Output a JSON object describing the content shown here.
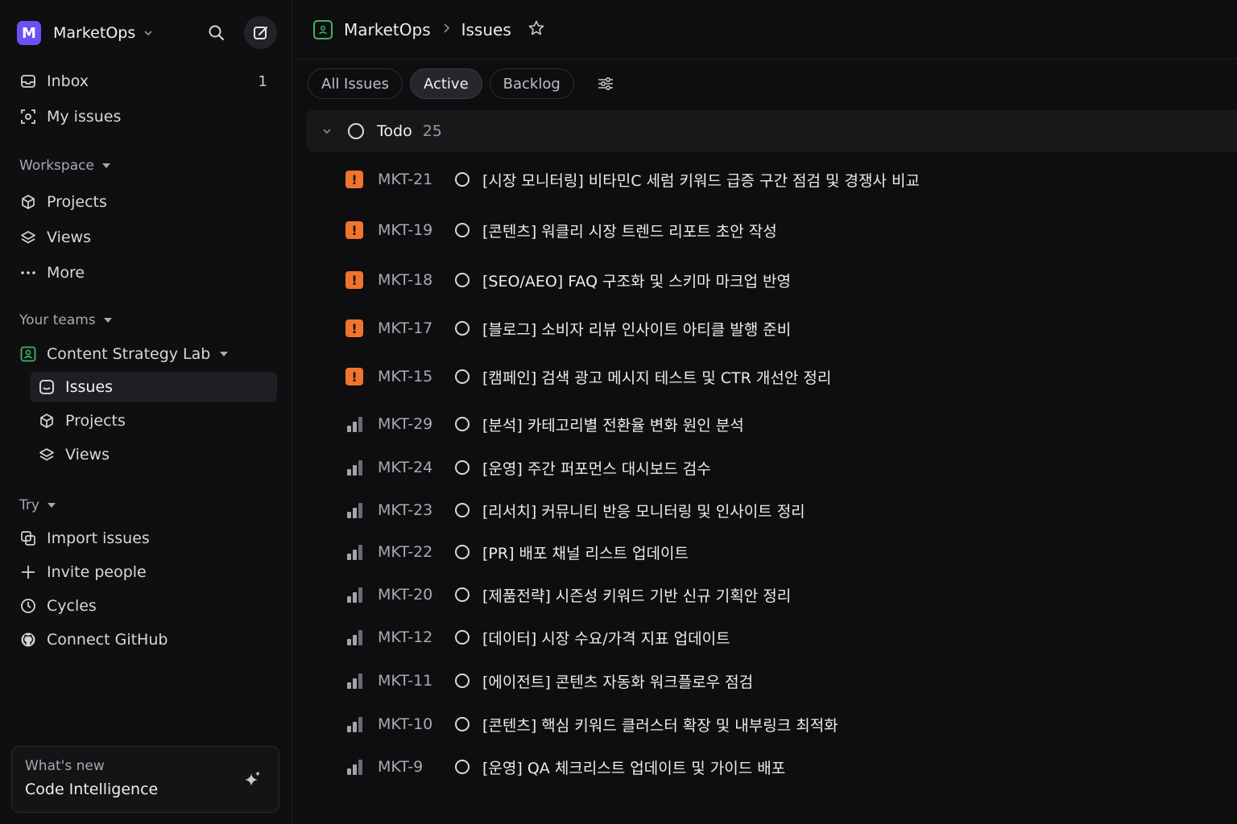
{
  "workspace": {
    "initial": "M",
    "name": "MarketOps"
  },
  "sidebar": {
    "top": [
      {
        "label": "Inbox",
        "count": "1"
      },
      {
        "label": "My issues"
      }
    ],
    "workspace_label": "Workspace",
    "workspace_items": [
      {
        "label": "Projects"
      },
      {
        "label": "Views"
      },
      {
        "label": "More"
      }
    ],
    "teams_label": "Your teams",
    "team_name": "Content Strategy Lab",
    "team_items": [
      {
        "label": "Issues"
      },
      {
        "label": "Projects"
      },
      {
        "label": "Views"
      }
    ],
    "try_label": "Try",
    "try_items": [
      {
        "label": "Import issues"
      },
      {
        "label": "Invite people"
      },
      {
        "label": "Cycles"
      },
      {
        "label": "Connect GitHub"
      }
    ],
    "whats_new": {
      "label": "What's new",
      "title": "Code Intelligence"
    }
  },
  "breadcrumb": {
    "team": "MarketOps",
    "page": "Issues"
  },
  "tabs": [
    {
      "label": "All Issues"
    },
    {
      "label": "Active"
    },
    {
      "label": "Backlog"
    }
  ],
  "group": {
    "label": "Todo",
    "count": "25"
  },
  "issues": [
    {
      "id": "MKT-21",
      "priority": "urgent",
      "title": "[시장 모니터링] 비타민C 세럼 키워드 급증 구간 점검 및 경쟁사 비교"
    },
    {
      "id": "MKT-19",
      "priority": "urgent",
      "title": "[콘텐츠] 워클리 시장 트렌드 리포트 초안 작성"
    },
    {
      "id": "MKT-18",
      "priority": "urgent",
      "title": "[SEO/AEO] FAQ 구조화 및 스키마 마크업 반영"
    },
    {
      "id": "MKT-17",
      "priority": "urgent",
      "title": "[블로그] 소비자 리뷰 인사이트 아티클 발행 준비"
    },
    {
      "id": "MKT-15",
      "priority": "urgent",
      "title": "[캠페인] 검색 광고 메시지 테스트 및 CTR 개선안 정리"
    },
    {
      "id": "MKT-29",
      "priority": "medium",
      "title": "[분석] 카테고리별 전환율 변화 원인 분석"
    },
    {
      "id": "MKT-24",
      "priority": "medium",
      "title": "[운영] 주간 퍼포먼스 대시보드 검수"
    },
    {
      "id": "MKT-23",
      "priority": "medium",
      "title": "[리서치] 커뮤니티 반응 모니터링 및 인사이트 정리"
    },
    {
      "id": "MKT-22",
      "priority": "medium",
      "title": "[PR] 배포 채널 리스트 업데이트"
    },
    {
      "id": "MKT-20",
      "priority": "medium",
      "title": "[제품전략] 시즌성 키워드 기반 신규 기획안 정리"
    },
    {
      "id": "MKT-12",
      "priority": "medium",
      "title": "[데이터] 시장 수요/가격 지표 업데이트"
    },
    {
      "id": "MKT-11",
      "priority": "medium",
      "title": "[에이전트] 콘텐츠 자동화 워크플로우 점검"
    },
    {
      "id": "MKT-10",
      "priority": "medium",
      "title": "[콘텐츠] 핵심 키워드 클러스터 확장 및 내부링크 최적화"
    },
    {
      "id": "MKT-9",
      "priority": "medium",
      "title": "[운영] QA 체크리스트 업데이트 및 가이드 배포"
    }
  ],
  "colors": {
    "accent": "#6d4ff2",
    "urgent": "#f0742e",
    "team": "#41b35d"
  }
}
